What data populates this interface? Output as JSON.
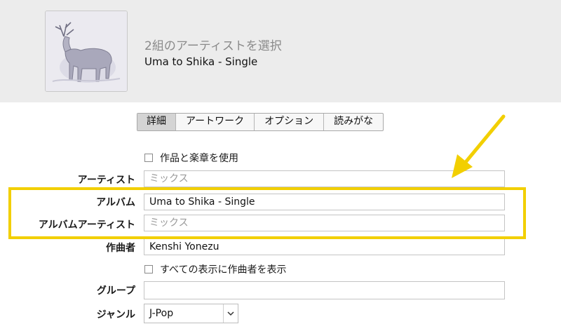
{
  "header": {
    "title": "2組のアーティストを選択",
    "subtitle": "Uma to Shika - Single"
  },
  "tabs": [
    {
      "label": "詳細",
      "active": true
    },
    {
      "label": "アートワーク",
      "active": false
    },
    {
      "label": "オプション",
      "active": false
    },
    {
      "label": "読みがな",
      "active": false
    }
  ],
  "form": {
    "use_work_movement": {
      "label": "作品と楽章を使用",
      "checked": false
    },
    "artist": {
      "label": "アーティスト",
      "value": "",
      "placeholder": "ミックス"
    },
    "album": {
      "label": "アルバム",
      "value": "Uma to Shika - Single"
    },
    "album_artist": {
      "label": "アルバムアーティスト",
      "value": "",
      "placeholder": "ミックス"
    },
    "composer": {
      "label": "作曲者",
      "value": "Kenshi Yonezu"
    },
    "show_composer": {
      "label": "すべての表示に作曲者を表示",
      "checked": false
    },
    "grouping": {
      "label": "グループ",
      "value": ""
    },
    "genre": {
      "label": "ジャンル",
      "value": "J-Pop"
    }
  },
  "annotation": {
    "color": "#f2cf00"
  }
}
